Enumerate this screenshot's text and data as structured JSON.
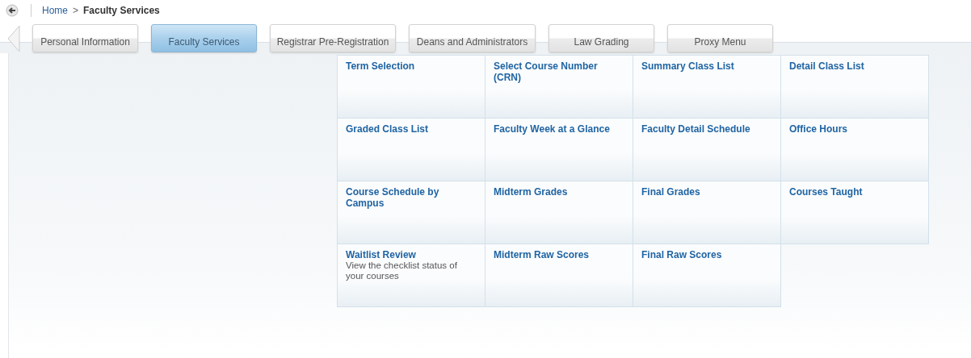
{
  "breadcrumb": {
    "home": "Home",
    "separator": ">",
    "current": "Faculty Services"
  },
  "tabs": [
    {
      "label": "Personal Information",
      "selected": false
    },
    {
      "label": "Faculty Services",
      "selected": true
    },
    {
      "label": "Registrar Pre-Registration",
      "selected": false
    },
    {
      "label": "Deans and Administrators",
      "selected": false
    },
    {
      "label": "Law Grading",
      "selected": false
    },
    {
      "label": "Proxy Menu",
      "selected": false
    }
  ],
  "menu_items": [
    {
      "title": "Term Selection"
    },
    {
      "title": "Select Course Number (CRN)"
    },
    {
      "title": "Summary Class List"
    },
    {
      "title": "Detail Class List"
    },
    {
      "title": "Graded Class List"
    },
    {
      "title": "Faculty Week at a Glance"
    },
    {
      "title": "Faculty Detail Schedule"
    },
    {
      "title": "Office Hours"
    },
    {
      "title": "Course Schedule by Campus"
    },
    {
      "title": "Midterm Grades"
    },
    {
      "title": "Final Grades"
    },
    {
      "title": "Courses Taught"
    },
    {
      "title": "Waitlist Review",
      "description": "View the checklist status of your courses"
    },
    {
      "title": "Midterm Raw Scores"
    },
    {
      "title": "Final Raw Scores"
    }
  ]
}
